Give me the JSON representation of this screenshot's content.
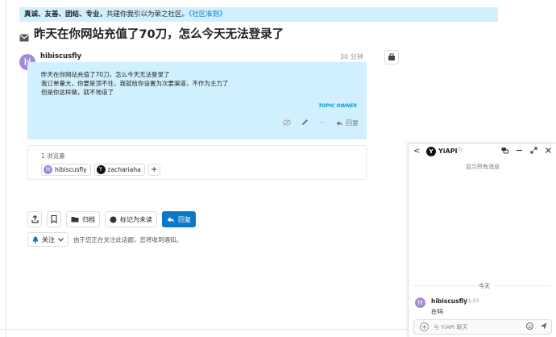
{
  "banner": {
    "bold": "真诚、友善、团结、专业，",
    "text": "共建你我引以为荣之社区。",
    "link": "《社区准则》"
  },
  "topic": {
    "title": "昨天在你网站充值了70刀，怎么今天无法登录了"
  },
  "post": {
    "avatar_letter": "H",
    "username": "hibiscusfly",
    "time": "30 分钟",
    "lines": [
      "昨天在你网站充值了70刀，怎么今天无法登录了",
      "我订单量大，你要是顶不住，我就给你设置为次要渠道，不作为主力了",
      "但是你这样做，就不地道了"
    ],
    "owner_tag": "TOPIC OWNER",
    "actions": {
      "more": "···",
      "reply": "回复"
    }
  },
  "meta": {
    "views": "1 浏览量",
    "users": [
      {
        "letter": "H",
        "name": "hibiscusfly",
        "color": "#a48ad3"
      },
      {
        "letter": "Y",
        "name": "zachariaha",
        "color": "#111111"
      }
    ],
    "plus": "+"
  },
  "controls": {
    "archive": "归档",
    "mark_unread": "标记为未读",
    "reply": "回复"
  },
  "notification": {
    "button": "关注",
    "text": "由于您正在关注此话题，您将收到通知。"
  },
  "chat": {
    "back": "<",
    "logo_letter": "Y",
    "title": "YiAPI",
    "star": "☆",
    "show_all": "显示所有消息",
    "today": "今天",
    "message": {
      "avatar_letter": "H",
      "user": "hibiscusfly",
      "time": "21:53",
      "text": "在吗"
    },
    "composer_placeholder": "与 YiAPI 聊天"
  },
  "colors": {
    "accent": "#0a78c8",
    "highlight_bg": "#d1f0ff",
    "owner_tag": "#0a9bd6",
    "avatar_purple": "#a48ad3"
  }
}
